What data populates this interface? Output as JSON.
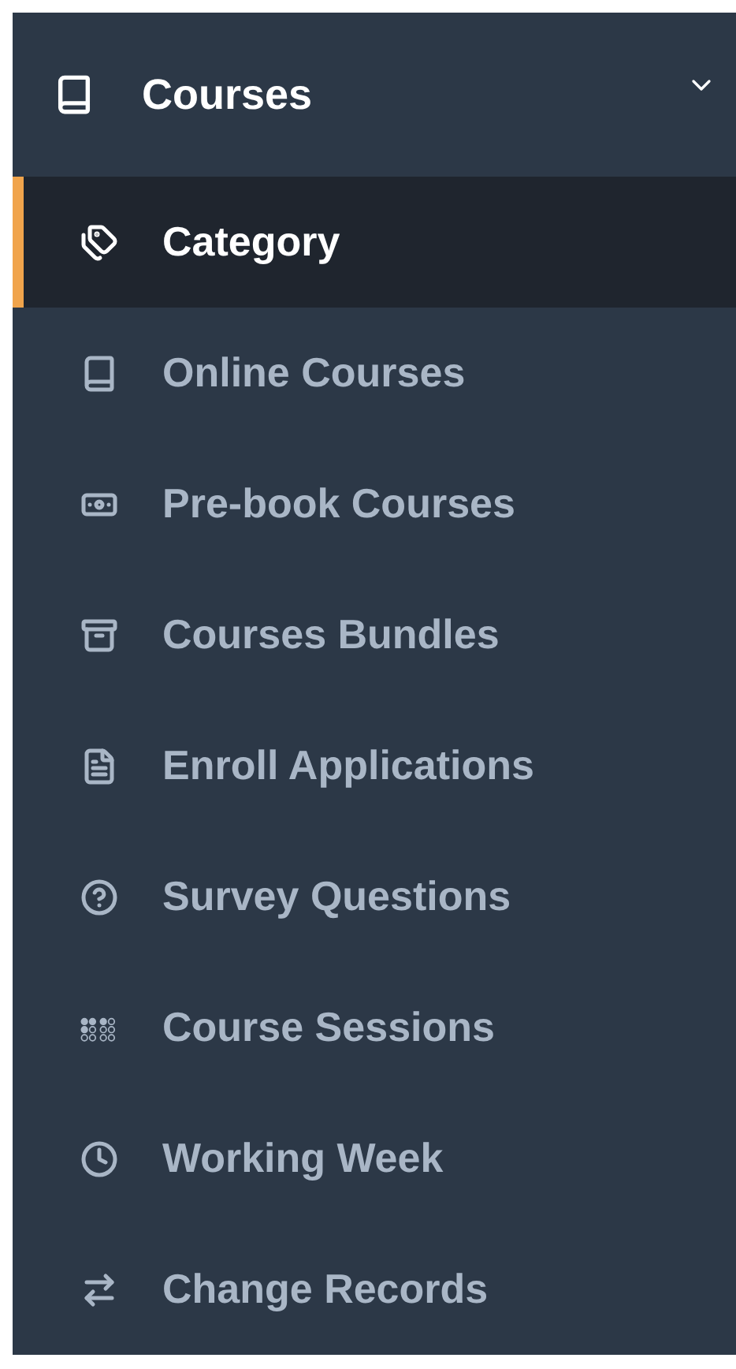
{
  "menu": {
    "title": "Courses",
    "kind": "book",
    "expanded": true,
    "items": [
      {
        "label": "Category",
        "kind": "tags",
        "selected": true
      },
      {
        "label": "Online Courses",
        "kind": "book",
        "selected": false
      },
      {
        "label": "Pre-book Courses",
        "kind": "money",
        "selected": false
      },
      {
        "label": "Courses Bundles",
        "kind": "archive",
        "selected": false
      },
      {
        "label": "Enroll Applications",
        "kind": "file",
        "selected": false
      },
      {
        "label": "Survey Questions",
        "kind": "question",
        "selected": false
      },
      {
        "label": "Course Sessions",
        "kind": "dots",
        "selected": false
      },
      {
        "label": "Working Week",
        "kind": "clock",
        "selected": false
      },
      {
        "label": "Change Records",
        "kind": "exchange",
        "selected": false
      }
    ]
  }
}
